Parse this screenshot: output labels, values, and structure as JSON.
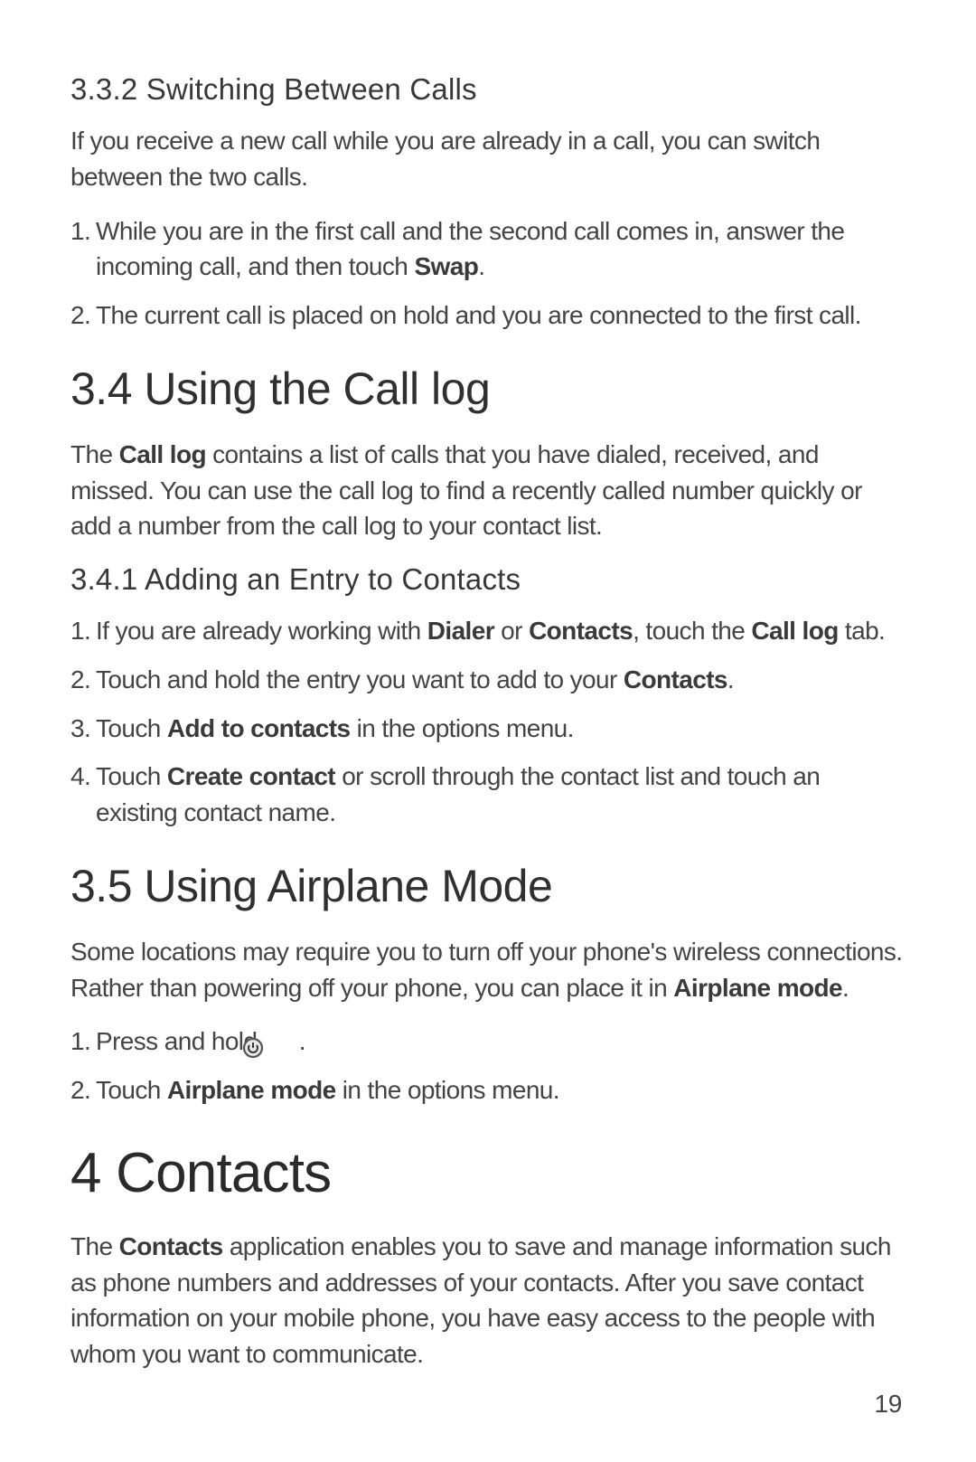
{
  "section_332": {
    "heading": "3.3.2  Switching Between Calls",
    "intro": "If you receive a new call while you are already in a call, you can switch between the two calls.",
    "step1_pre": "While you are in the first call and the second call comes in, answer the incoming call, and then touch ",
    "step1_bold": "Swap",
    "step1_post": ".",
    "step2": "The current call is placed on hold and you are connected to the first call."
  },
  "section_34": {
    "heading": "3.4  Using the Call log",
    "intro_pre": "The ",
    "intro_bold": "Call log",
    "intro_post": " contains a list of calls that you have dialed, received, and missed. You can use the call log to find a recently called number quickly or add a number from the call log to your contact list."
  },
  "section_341": {
    "heading": "3.4.1  Adding an Entry to Contacts",
    "step1_pre": "If you are already working with ",
    "step1_b1": "Dialer",
    "step1_mid1": " or ",
    "step1_b2": "Contacts",
    "step1_mid2": ", touch the ",
    "step1_b3": "Call log",
    "step1_post": " tab.",
    "step2_pre": "Touch and hold the entry you want to add to your ",
    "step2_bold": "Contacts",
    "step2_post": ".",
    "step3_pre": "Touch ",
    "step3_bold": "Add to contacts",
    "step3_post": " in the options menu.",
    "step4_pre": "Touch ",
    "step4_bold": "Create contact",
    "step4_post": " or scroll through the contact list and touch an existing contact name."
  },
  "section_35": {
    "heading": "3.5  Using Airplane Mode",
    "intro_pre": "Some locations may require you to turn off your phone's wireless connections. Rather than powering off your phone, you can place it in ",
    "intro_bold": "Airplane mode",
    "intro_post": ".",
    "step1_pre": "Press and hold ",
    "step1_post": " .",
    "step2_pre": "Touch ",
    "step2_bold": "Airplane mode",
    "step2_post": " in the options menu."
  },
  "section_4": {
    "heading": "4  Contacts",
    "intro_pre": "The ",
    "intro_bold": "Contacts",
    "intro_post": " application enables you to save and manage information such as phone numbers and addresses of your contacts. After you save contact information on your mobile phone, you have easy access to the people with whom you want to communicate."
  },
  "page_number": "19",
  "numbers": {
    "n1": "1.",
    "n2": "2.",
    "n3": "3.",
    "n4": "4."
  }
}
